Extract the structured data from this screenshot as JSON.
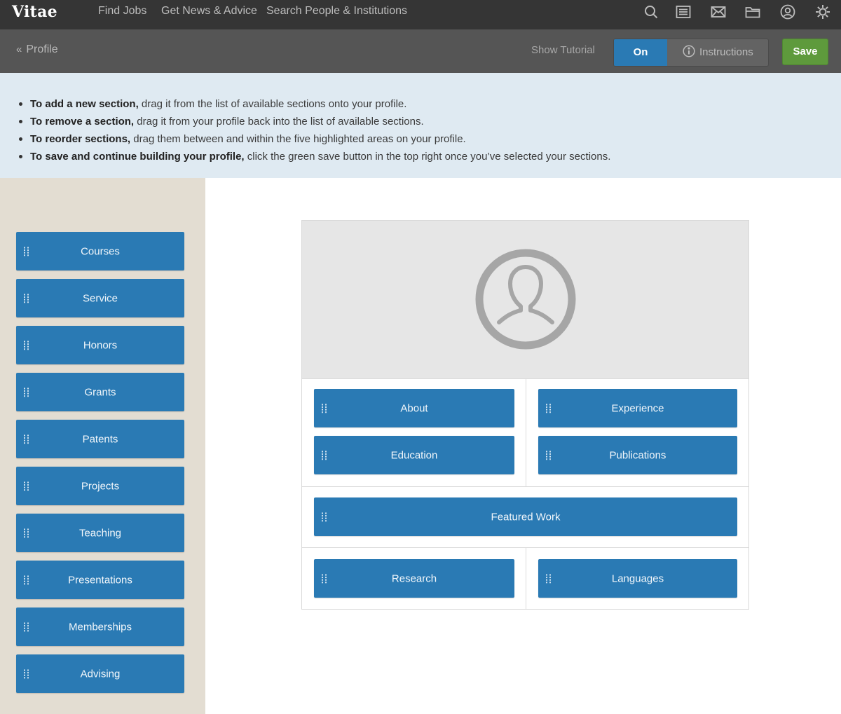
{
  "app": {
    "logo": "Vitae"
  },
  "topnav": {
    "links": [
      "Find Jobs",
      "Get News & Advice",
      "Search People & Institutions"
    ],
    "icons": [
      "search-icon",
      "newspaper-icon",
      "mail-icon",
      "folder-icon",
      "user-circle-icon",
      "gear-icon"
    ]
  },
  "subnav": {
    "back_label": "Profile",
    "show_tutorial": "Show Tutorial",
    "toggle_on": "On",
    "instructions": "Instructions",
    "save": "Save"
  },
  "instructions": {
    "items": [
      {
        "bold": "To add a new section,",
        "text": " drag it from the list of available sections onto your profile."
      },
      {
        "bold": "To remove a section,",
        "text": " drag it from your profile back into the list of available sections."
      },
      {
        "bold": "To reorder sections,",
        "text": " drag them between and within the five highlighted areas on your profile."
      },
      {
        "bold": "To save and continue building your profile,",
        "text": " click the green save button in the top right once you’ve selected your sections."
      }
    ]
  },
  "available_sections": [
    "Courses",
    "Service",
    "Honors",
    "Grants",
    "Patents",
    "Projects",
    "Teaching",
    "Presentations",
    "Memberships",
    "Advising"
  ],
  "profile": {
    "left_column": [
      "About",
      "Education"
    ],
    "right_column": [
      "Experience",
      "Publications"
    ],
    "featured": "Featured Work",
    "bottom_left": "Research",
    "bottom_right": "Languages"
  },
  "colors": {
    "topnav_bg": "#353535",
    "subnav_bg": "#555555",
    "accent_blue": "#2a7ab4",
    "save_green": "#5e9a3c",
    "instructions_bg": "#dfeaf2",
    "sidebar_bg": "#e3ddd2"
  }
}
